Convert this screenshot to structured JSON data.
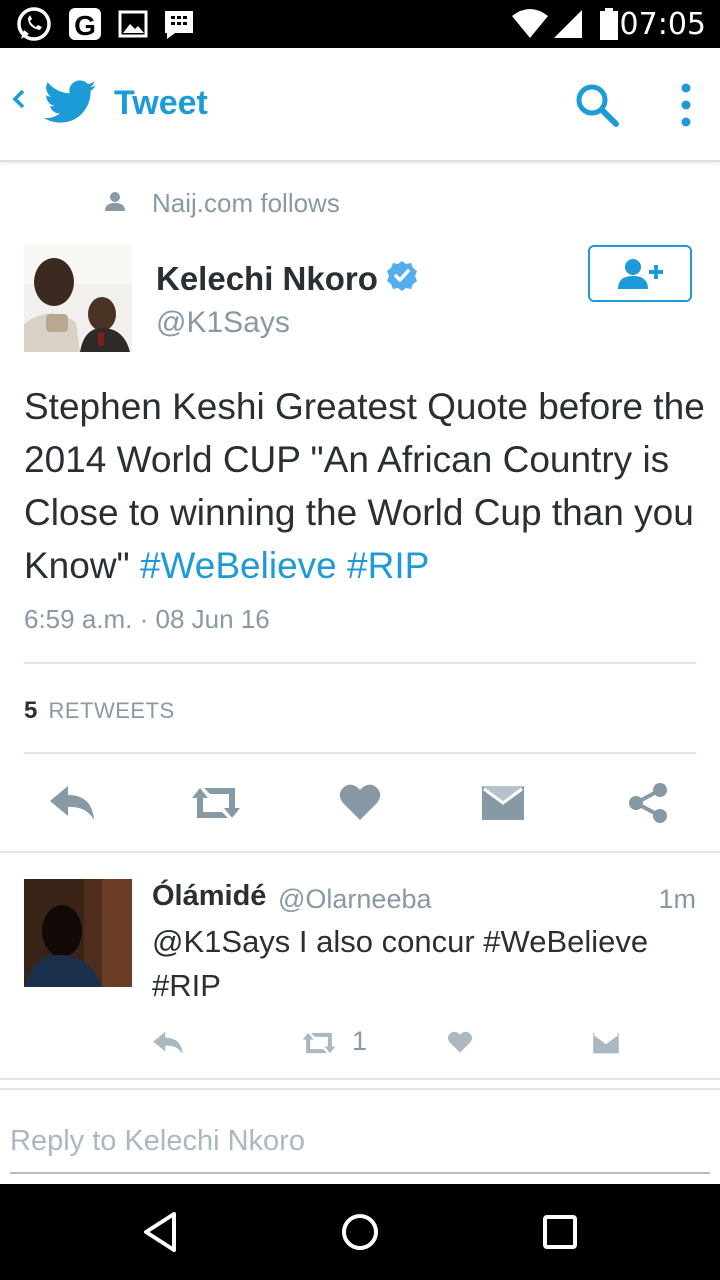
{
  "status_bar": {
    "time": "07:05",
    "icons": [
      "whatsapp-icon",
      "g-icon",
      "image-icon",
      "bbm-icon",
      "wifi-icon",
      "signal-icon",
      "battery-icon"
    ]
  },
  "header": {
    "title": "Tweet",
    "icons": [
      "back-icon",
      "twitter-bird-icon",
      "search-icon",
      "more-vert-icon"
    ],
    "accent_color": "#1d9bd8"
  },
  "social_context": "Naij.com follows",
  "tweet": {
    "author_name": "Kelechi Nkoro",
    "author_handle": "@K1Says",
    "text_plain": "Stephen Keshi Greatest Quote before the 2014 World CUP \"An African Country is Close to winning the World Cup than you Know\" ",
    "hashtag_1": "#WeBelieve",
    "hashtag_2": "#RIP",
    "timestamp": "6:59 a.m. · 08 Jun 16",
    "retweet_count": "5",
    "retweet_label": "RETWEETS"
  },
  "reply": {
    "name": "Ólámidé",
    "handle": "@Olarneeba",
    "time": "1m",
    "text": "@K1Says I also concur #WeBelieve #RIP",
    "retweet_count": "1"
  },
  "composer": {
    "placeholder": "Reply to Kelechi Nkoro"
  }
}
